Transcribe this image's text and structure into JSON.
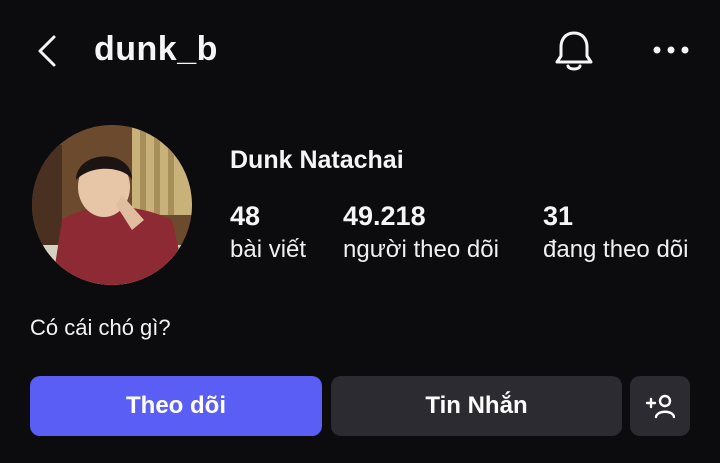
{
  "header": {
    "username": "dunk_b"
  },
  "profile": {
    "display_name": "Dunk Natachai",
    "stats": [
      {
        "value": "48",
        "label": "bài viết"
      },
      {
        "value": "49.218",
        "label": "người theo dõi"
      },
      {
        "value": "31",
        "label": "đang theo dõi"
      }
    ],
    "bio": "Có cái chó gì?"
  },
  "actions": {
    "follow_label": "Theo dõi",
    "message_label": "Tin Nhắn",
    "add_user_label": "+"
  },
  "colors": {
    "background": "#0c0c0f",
    "primary_button": "#5a5ef5",
    "secondary_button": "#2b2b31"
  },
  "icons": {
    "back": "chevron-left-icon",
    "notifications": "bell-icon",
    "more": "more-horizontal-icon",
    "add_user": "add-user-icon"
  }
}
